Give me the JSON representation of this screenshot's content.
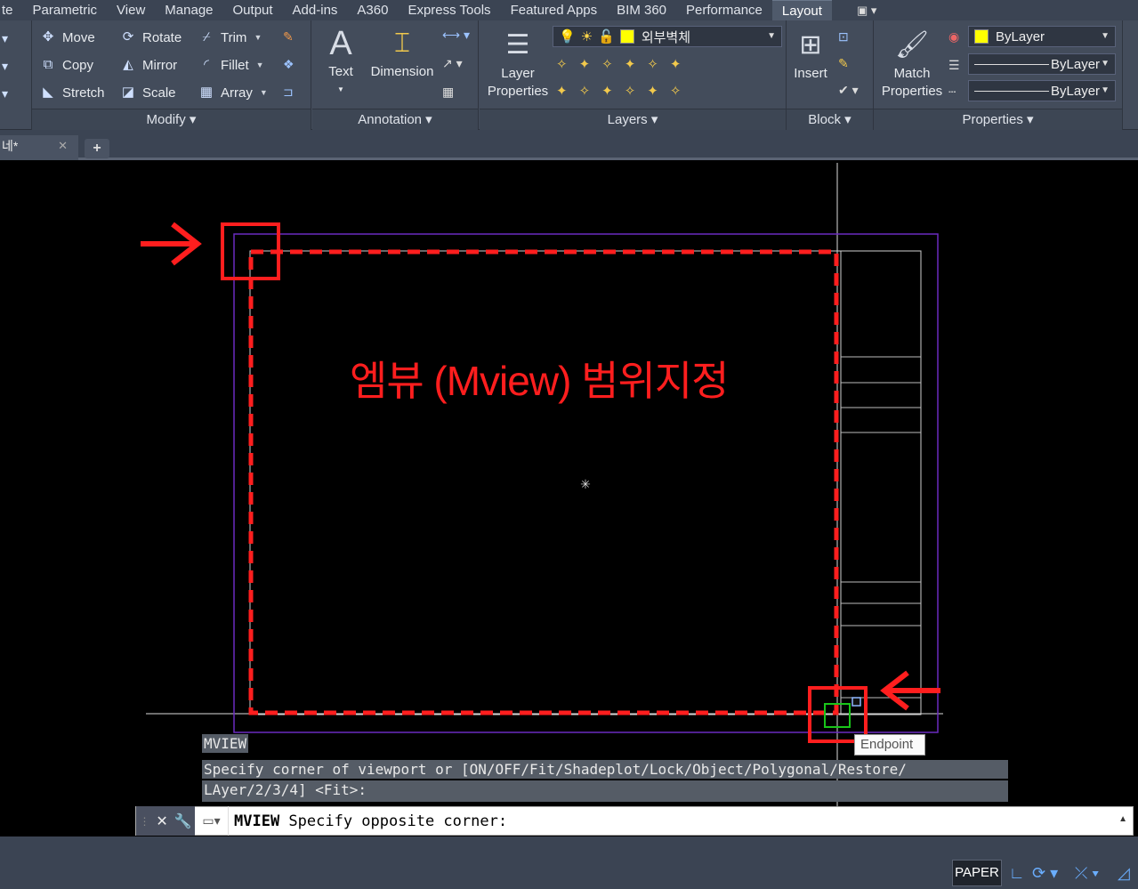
{
  "menu": {
    "tabs": [
      "te",
      "Parametric",
      "View",
      "Manage",
      "Output",
      "Add-ins",
      "A360",
      "Express Tools",
      "Featured Apps",
      "BIM 360",
      "Performance",
      "Layout"
    ],
    "active_tab": "Layout",
    "extra": "▣ ▾"
  },
  "ribbon": {
    "modify": {
      "title": "Modify ▾",
      "move": "Move",
      "rotate": "Rotate",
      "trim": "Trim",
      "copy": "Copy",
      "mirror": "Mirror",
      "fillet": "Fillet",
      "stretch": "Stretch",
      "scale": "Scale",
      "array": "Array"
    },
    "annotation": {
      "title": "Annotation ▾",
      "text": "Text",
      "dimension": "Dimension"
    },
    "layers": {
      "title": "Layers ▾",
      "layer_properties_line1": "Layer",
      "layer_properties_line2": "Properties",
      "current_layer": "외부벽체"
    },
    "block": {
      "title": "Block ▾",
      "insert": "Insert"
    },
    "properties": {
      "title": "Properties ▾",
      "match_line1": "Match",
      "match_line2": "Properties",
      "color": "ByLayer",
      "linetype": "ByLayer",
      "lineweight": "ByLayer",
      "color_swatch": "#ffff00"
    }
  },
  "doc": {
    "tab_label": "네*",
    "close": "✕",
    "plus": "+"
  },
  "canvas": {
    "annotation_text": "엠뷰 (Mview) 범위지정",
    "tooltip": "Endpoint",
    "accent_red": "#ff1e1e",
    "viewport_border_color": "#6a2bbf"
  },
  "command": {
    "history_cmd": "MVIEW",
    "history_line1": "Specify corner of viewport or [ON/OFF/Fit/Shadeplot/Lock/Object/Polygonal/Restore/",
    "history_line2": "LAyer/2/3/4] <Fit>:",
    "current_cmd": "MVIEW",
    "current_prompt": " Specify opposite corner:"
  },
  "status": {
    "paper": "PAPER"
  }
}
